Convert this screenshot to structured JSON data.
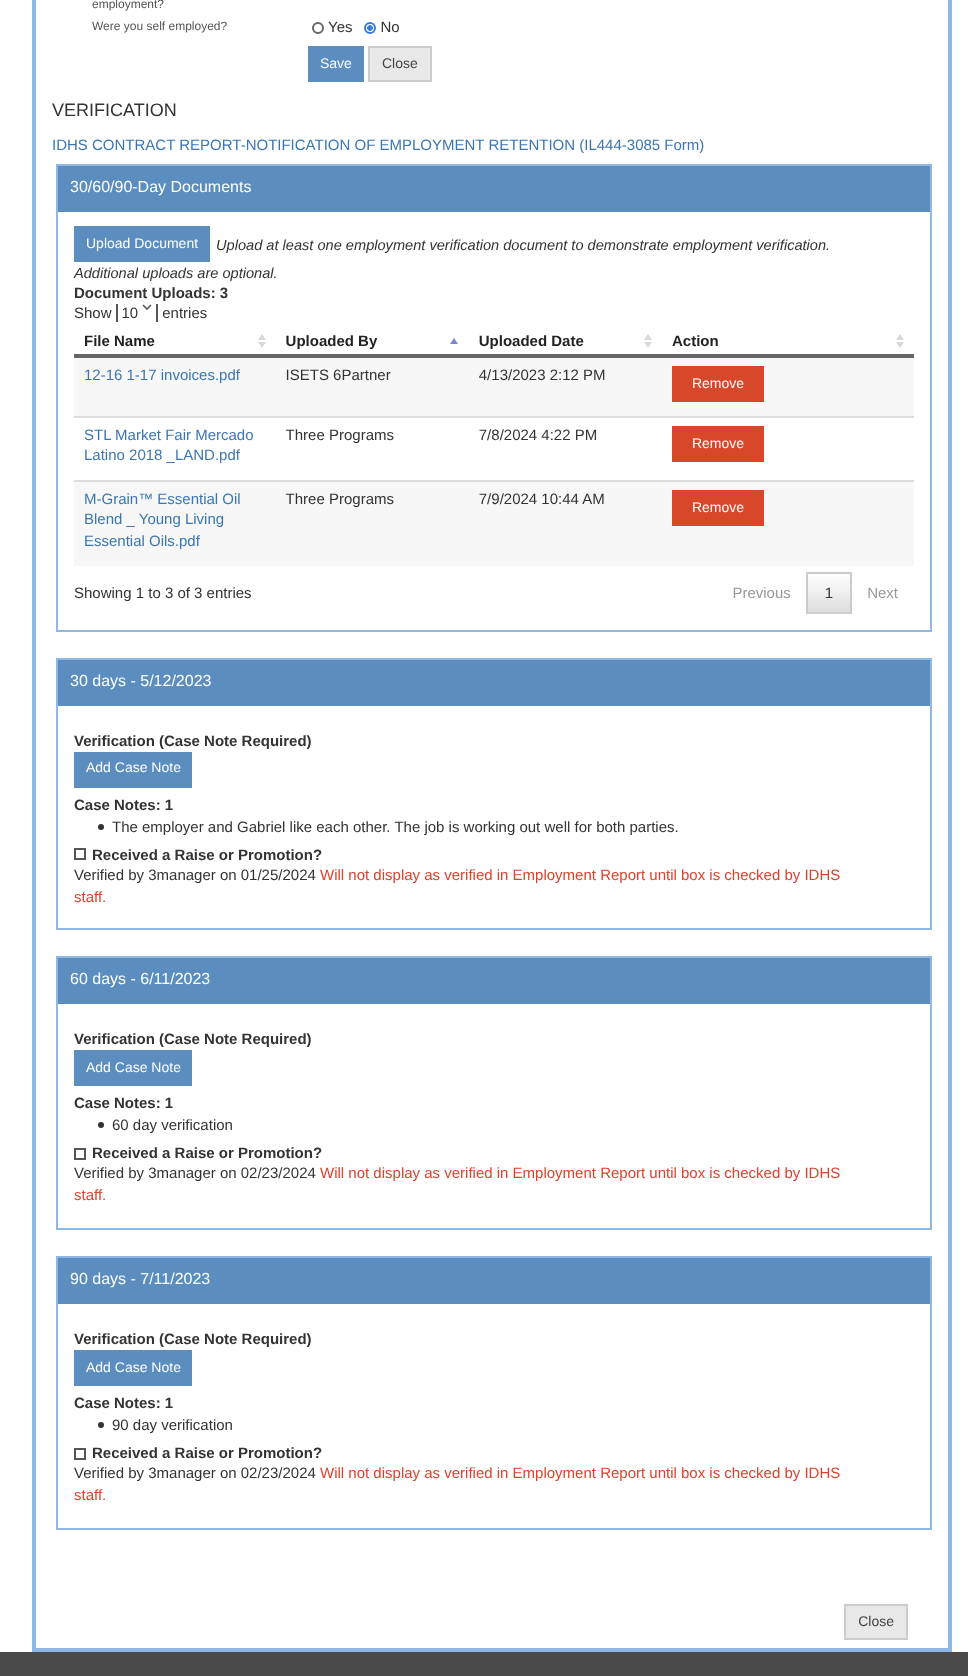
{
  "form": {
    "cut_label": "employment?",
    "fields": [
      {
        "label": "Were you self employed?",
        "kind": "radio",
        "options": [
          {
            "label": "Yes",
            "selected": false
          },
          {
            "label": "No",
            "selected": true
          }
        ]
      }
    ],
    "buttons": [
      {
        "label": "Save",
        "kind": "primary"
      },
      {
        "label": "Close",
        "kind": "default"
      }
    ]
  },
  "heading": "VERIFICATION",
  "link": "IDHS CONTRACT REPORT-NOTIFICATION OF EMPLOYMENT RETENTION (IL444-3085 Form)",
  "documents": {
    "title": "30/60/90-Day Documents",
    "upload_button": "Upload Document",
    "instructions": "Upload at least one employment verification document to demonstrate employment verification.",
    "optional_note": "Additional uploads are optional.",
    "count": "Document Uploads: 3",
    "length": {
      "before": "Show",
      "value": "10",
      "after": "entries"
    },
    "columns": [
      {
        "label": "File Name",
        "sorted": false
      },
      {
        "label": "Uploaded By",
        "sorted": true
      },
      {
        "label": "Uploaded Date",
        "sorted": false
      },
      {
        "label": "Action",
        "sorted": false
      }
    ],
    "rows": [
      {
        "file": "12-16 1-17 invoices.pdf",
        "by": "ISETS 6Partner",
        "date": "4/13/2023 2:12 PM",
        "action": "Remove"
      },
      {
        "file": "STL Market Fair Mercado Latino 2018 _LAND.pdf",
        "by": "Three Programs",
        "date": "7/8/2024 4:22 PM",
        "action": "Remove"
      },
      {
        "file": "M-Grain™ Essential Oil Blend _ Young Living Essential Oils.pdf",
        "by": "Three Programs",
        "date": "7/9/2024 10:44 AM",
        "action": "Remove"
      }
    ],
    "info": "Showing 1 to 3 of 3 entries",
    "pagination": [
      {
        "label": "Previous",
        "kind": "nav",
        "selected": false
      },
      {
        "label": "1",
        "kind": "page",
        "selected": true
      },
      {
        "label": "Next",
        "kind": "nav",
        "selected": false
      }
    ]
  },
  "periods": [
    {
      "title": "30 days - 5/12/2023",
      "verification_label": "Verification (Case Note Required)",
      "add_button": "Add Case Note",
      "notes_count": "Case Notes: 1",
      "notes": [
        "The employer and Gabriel like each other. The job is working out well for both parties."
      ],
      "raise": {
        "label": "Received a Raise or Promotion?",
        "checked": false
      },
      "verified_by": "Verified by 3manager on 01/25/2024",
      "warning": "Will not display as verified in Employment Report until box is checked by IDHS staff."
    },
    {
      "title": "60 days - 6/11/2023",
      "verification_label": "Verification (Case Note Required)",
      "add_button": "Add Case Note",
      "notes_count": "Case Notes: 1",
      "notes": [
        "60 day verification"
      ],
      "raise": {
        "label": "Received a Raise or Promotion?",
        "checked": false
      },
      "verified_by": "Verified by 3manager on 02/23/2024",
      "warning": "Will not display as verified in Employment Report until box is checked by IDHS staff."
    },
    {
      "title": "90 days - 7/11/2023",
      "verification_label": "Verification (Case Note Required)",
      "add_button": "Add Case Note",
      "notes_count": "Case Notes: 1",
      "notes": [
        "90 day verification"
      ],
      "raise": {
        "label": "Received a Raise or Promotion?",
        "checked": false
      },
      "verified_by": "Verified by 3manager on 02/23/2024",
      "warning": "Will not display as verified in Employment Report until box is checked by IDHS staff."
    }
  ],
  "footer_button": "Close"
}
